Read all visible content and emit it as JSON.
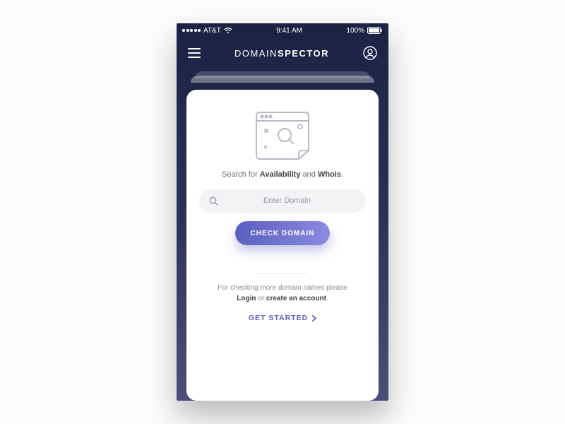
{
  "status": {
    "carrier": "AT&T",
    "time": "9:41 AM",
    "battery": "100%"
  },
  "nav": {
    "title_a": "DOMAIN",
    "title_b": "SPECTOR"
  },
  "card": {
    "tag_pre": "Search for ",
    "tag_strong1": "Availability",
    "tag_mid": " and ",
    "tag_strong2": "Whois",
    "tag_post": ".",
    "search_placeholder": "Enter Domain",
    "cta_label": "CHECK DOMAIN",
    "hint_pre": "For checking more domain names  please",
    "hint_strong1": "Login",
    "hint_mid": " or ",
    "hint_strong2": "create an account",
    "hint_post": ".",
    "link_label": "GET STARTED"
  }
}
